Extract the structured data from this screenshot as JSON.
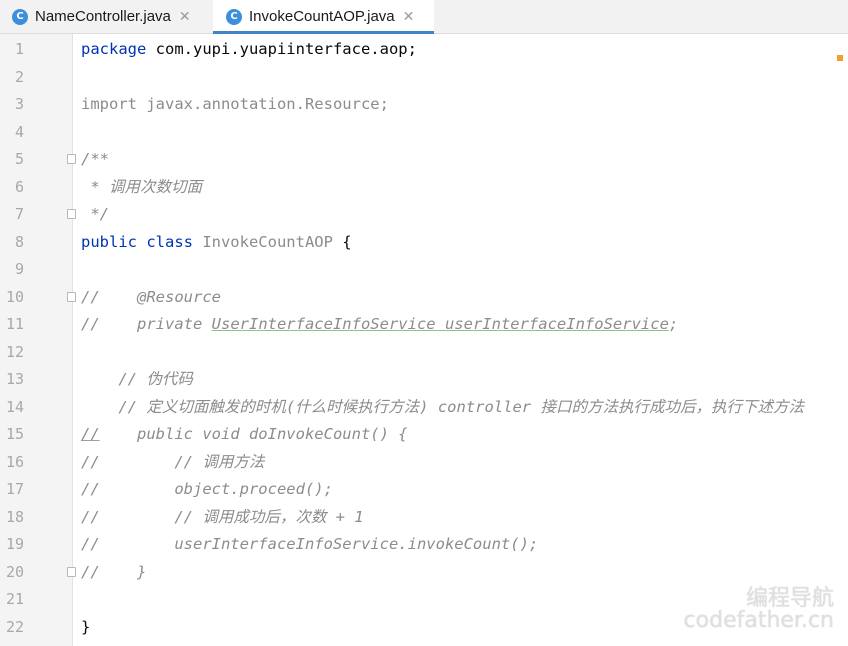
{
  "tabs": [
    {
      "icon": "class-icon",
      "icon_letter": "C",
      "label": "NameController.java",
      "active": false
    },
    {
      "icon": "class-icon",
      "icon_letter": "C",
      "label": "InvokeCountAOP.java",
      "active": true
    }
  ],
  "close_glyph": "✕",
  "lines": [
    {
      "num": "1",
      "fold": false,
      "segments": [
        {
          "t": "package",
          "s": "kw"
        },
        {
          "t": " com.yupi.yuapiinterface.aop;",
          "s": "pl"
        }
      ]
    },
    {
      "num": "2",
      "fold": false,
      "segments": []
    },
    {
      "num": "3",
      "fold": false,
      "segments": [
        {
          "t": "import javax.annotation.Resource;",
          "s": "cm"
        }
      ]
    },
    {
      "num": "4",
      "fold": false,
      "segments": []
    },
    {
      "num": "5",
      "fold": true,
      "segments": [
        {
          "t": "/**",
          "s": "ci"
        }
      ]
    },
    {
      "num": "6",
      "fold": false,
      "segments": [
        {
          "t": " * 调用次数切面",
          "s": "ci"
        }
      ]
    },
    {
      "num": "7",
      "fold": true,
      "segments": [
        {
          "t": " */",
          "s": "ci"
        }
      ]
    },
    {
      "num": "8",
      "fold": false,
      "segments": [
        {
          "t": "public class",
          "s": "kw"
        },
        {
          "t": " InvokeCountAOP ",
          "s": "cm"
        },
        {
          "t": "{",
          "s": "pl"
        }
      ]
    },
    {
      "num": "9",
      "fold": false,
      "segments": []
    },
    {
      "num": "10",
      "fold": true,
      "segments": [
        {
          "t": "//    @Resource",
          "s": "ci"
        }
      ]
    },
    {
      "num": "11",
      "fold": false,
      "segments": [
        {
          "t": "//    private ",
          "s": "ci"
        },
        {
          "t": "UserInterfaceInfoService userInterfaceInfoService",
          "s": "ci ul"
        },
        {
          "t": ";",
          "s": "ci"
        }
      ]
    },
    {
      "num": "12",
      "fold": false,
      "segments": []
    },
    {
      "num": "13",
      "fold": false,
      "segments": [
        {
          "t": "    // 伪代码",
          "s": "ci"
        }
      ]
    },
    {
      "num": "14",
      "fold": false,
      "segments": [
        {
          "t": "    // 定义切面触发的时机(什么时候执行方法) controller 接口的方法执行成功后，执行下述方法",
          "s": "ci"
        }
      ]
    },
    {
      "num": "15",
      "fold": false,
      "segments": [
        {
          "t": "//",
          "s": "ci wave"
        },
        {
          "t": "    public void doInvokeCount() {",
          "s": "ci"
        }
      ]
    },
    {
      "num": "16",
      "fold": false,
      "segments": [
        {
          "t": "//        // 调用方法",
          "s": "ci"
        }
      ]
    },
    {
      "num": "17",
      "fold": false,
      "segments": [
        {
          "t": "//        object.proceed();",
          "s": "ci"
        }
      ]
    },
    {
      "num": "18",
      "fold": false,
      "segments": [
        {
          "t": "//        // 调用成功后，次数 + 1",
          "s": "ci"
        }
      ]
    },
    {
      "num": "19",
      "fold": false,
      "segments": [
        {
          "t": "//        userInterfaceInfoService.invokeCount();",
          "s": "ci"
        }
      ]
    },
    {
      "num": "20",
      "fold": true,
      "segments": [
        {
          "t": "//    }",
          "s": "ci"
        }
      ]
    },
    {
      "num": "21",
      "fold": false,
      "segments": []
    },
    {
      "num": "22",
      "fold": false,
      "segments": [
        {
          "t": "}",
          "s": "pl"
        }
      ]
    }
  ],
  "watermark": {
    "line1": "编程导航",
    "line2": "codefather.cn"
  }
}
